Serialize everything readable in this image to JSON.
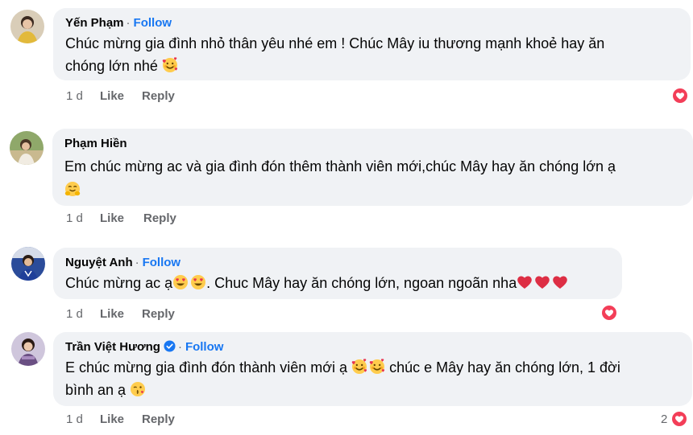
{
  "comments": [
    {
      "author": "Yến Phạm",
      "follow": "Follow",
      "lines": [
        "Chúc mừng gia đình nhỏ thân yêu nhé em ! Chúc Mây iu thương mạnh khoẻ hay ăn",
        "chóng lớn nhé"
      ],
      "time": "1 d",
      "like": "Like",
      "reply": "Reply",
      "reaction": "heart"
    },
    {
      "author": "Phạm Hiền",
      "lines": [
        "Em chúc mừng ac và gia đình đón thêm thành viên mới,chúc Mây hay ăn chóng lớn ạ"
      ],
      "time": "1 d",
      "like": "Like",
      "reply": "Reply"
    },
    {
      "author": "Nguyệt Anh",
      "follow": "Follow",
      "lines": [
        "Chúc mừng ac ạ",
        ". Chuc Mây hay ăn chóng lớn, ngoan ngoãn nha"
      ],
      "time": "1 d",
      "like": "Like",
      "reply": "Reply",
      "reaction": "heart"
    },
    {
      "author": "Trần Việt Hương",
      "follow": "Follow",
      "lines": [
        "E chúc mừng gia đình đón thành viên mới ạ",
        "chúc e Mây hay ăn chóng lớn, 1 đời",
        "bình an ạ"
      ],
      "time": "1 d",
      "like": "Like",
      "reply": "Reply",
      "reaction": "heart",
      "reaction_count": "2"
    }
  ],
  "colors": {
    "bubble": "#f0f2f5",
    "follow": "#1877f2",
    "muted": "#65676b",
    "heart": "#f33e58"
  }
}
